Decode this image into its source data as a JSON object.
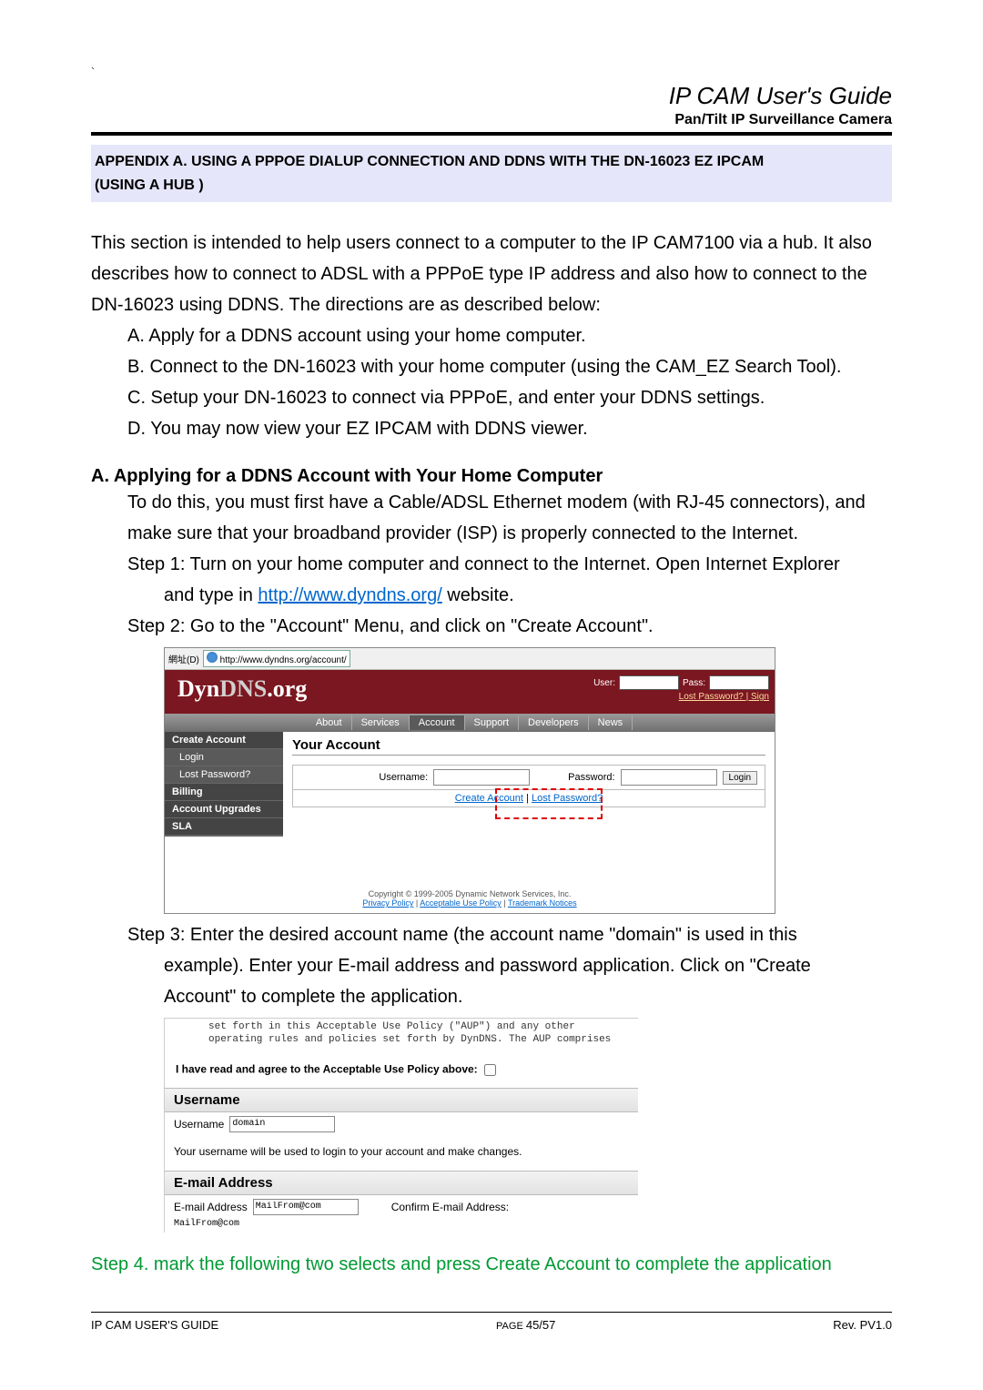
{
  "header": {
    "title": "IP CAM User's Guide",
    "subtitle": "Pan/Tilt IP Surveillance Camera",
    "backtick": "`"
  },
  "appendix": {
    "line1_a": "APPENDIX A. USING A PPPOE DIALUP CONNECTION AND DDNS WITH THE DN-16023 EZ IPCAM",
    "line2": "(USING A HUB )"
  },
  "intro": "This section is intended to help users connect to a computer to the IP CAM7100 via a hub. It also describes how to connect to ADSL with a PPPoE type IP address and also how to connect to the DN-16023 using DDNS. The directions are as described below:",
  "steps_top": {
    "a": "A. Apply for a DDNS account using your home computer.",
    "b": "B. Connect to the DN-16023 with your home computer (using the CAM_EZ Search Tool).",
    "c": "C. Setup your DN-16023 to connect via PPPoE, and enter your DDNS settings.",
    "d": "D. You may now view your EZ IPCAM with DDNS viewer."
  },
  "sectA": {
    "heading": "A. Applying for a DDNS Account with Your Home Computer",
    "p1": "To do this, you must first have a Cable/ADSL Ethernet modem (with RJ-45 connectors), and make sure that your broadband provider (ISP) is properly connected to the Internet.",
    "step1a": "Step 1: Turn on your home computer and connect to the Internet. Open Internet Explorer",
    "step1b": "and type in ",
    "step1_link": "http://www.dyndns.org/",
    "step1c": " website.",
    "step2": "Step 2: Go to the \"Account\" Menu, and click on \"Create Account\".",
    "step3a": "Step 3: Enter the desired account name (the account name \"domain\" is used in this",
    "step3b": "example). Enter your E-mail address and password application. Click on \"Create",
    "step3c": "Account\" to complete the application.",
    "step4": "Step 4. mark the following two selects and press Create Account to complete the application"
  },
  "shot1": {
    "addr_label": "網址(D)",
    "url": "http://www.dyndns.org/account/",
    "logo_a": "Dyn",
    "logo_b": "DNS",
    "logo_c": ".org",
    "user_lbl": "User:",
    "pass_lbl": "Pass:",
    "lost_sign": "Lost Password? | Sign",
    "nav": {
      "about": "About",
      "services": "Services",
      "account": "Account",
      "support": "Support",
      "developers": "Developers",
      "news": "News"
    },
    "sidebar": {
      "create": "Create Account",
      "login": "Login",
      "lost": "Lost Password?",
      "billing": "Billing",
      "upgrades": "Account Upgrades",
      "sla": "SLA"
    },
    "main_heading": "Your Account",
    "username_lbl": "Username:",
    "password_lbl": "Password:",
    "login_btn": "Login",
    "create_link": "Create Account",
    "lost_link": "Lost Password?",
    "sep": " | ",
    "footer1": "Copyright © 1999-2005 Dynamic Network Services, Inc.",
    "footer2a": "Privacy Policy",
    "footer2b": "Acceptable Use Policy",
    "footer2c": "Trademark Notices"
  },
  "shot2": {
    "aup1": "set forth in this Acceptable Use Policy (\"AUP\") and any other",
    "aup2": "operating rules and policies set forth by DynDNS.  The AUP comprises",
    "agree": "I have read and agree to the Acceptable Use Policy above:",
    "sect_username": "Username",
    "username_lbl": "Username",
    "username_val": "domain",
    "username_hint": "Your username will be used to login to your account and make changes.",
    "sect_email": "E-mail Address",
    "email_lbl": "E-mail Address",
    "email_val": "MailFrom@com",
    "confirm_lbl": "Confirm E-mail Address:",
    "confirm_val": "MailFrom@com"
  },
  "footer": {
    "left": "IP CAM USER'S GUIDE",
    "center_a": "PAGE ",
    "center_b": "45/57",
    "right": "Rev. PV1.0"
  }
}
